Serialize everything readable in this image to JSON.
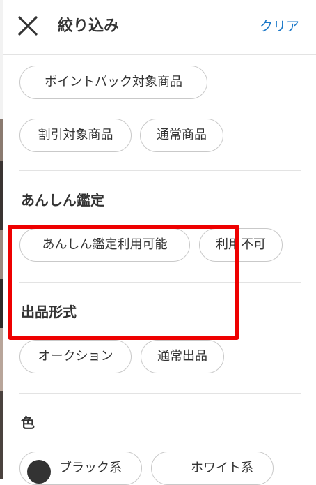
{
  "header": {
    "title": "絞り込み",
    "clear_label": "クリア"
  },
  "product_type": {
    "chips": [
      "ポイントバック対象商品",
      "割引対象商品",
      "通常商品"
    ]
  },
  "anshin": {
    "title": "あんしん鑑定",
    "chips": [
      "あんしん鑑定利用可能",
      "利用不可"
    ]
  },
  "listing_format": {
    "title": "出品形式",
    "chips": [
      "オークション",
      "通常出品"
    ]
  },
  "color": {
    "title": "色",
    "chips": [
      {
        "label": "ブラック系",
        "swatch": "#333333"
      },
      {
        "label": "ホワイト系",
        "swatch": "#ffffff"
      }
    ]
  },
  "highlight_color": "#ee0000",
  "accent_color": "#1b78c8"
}
